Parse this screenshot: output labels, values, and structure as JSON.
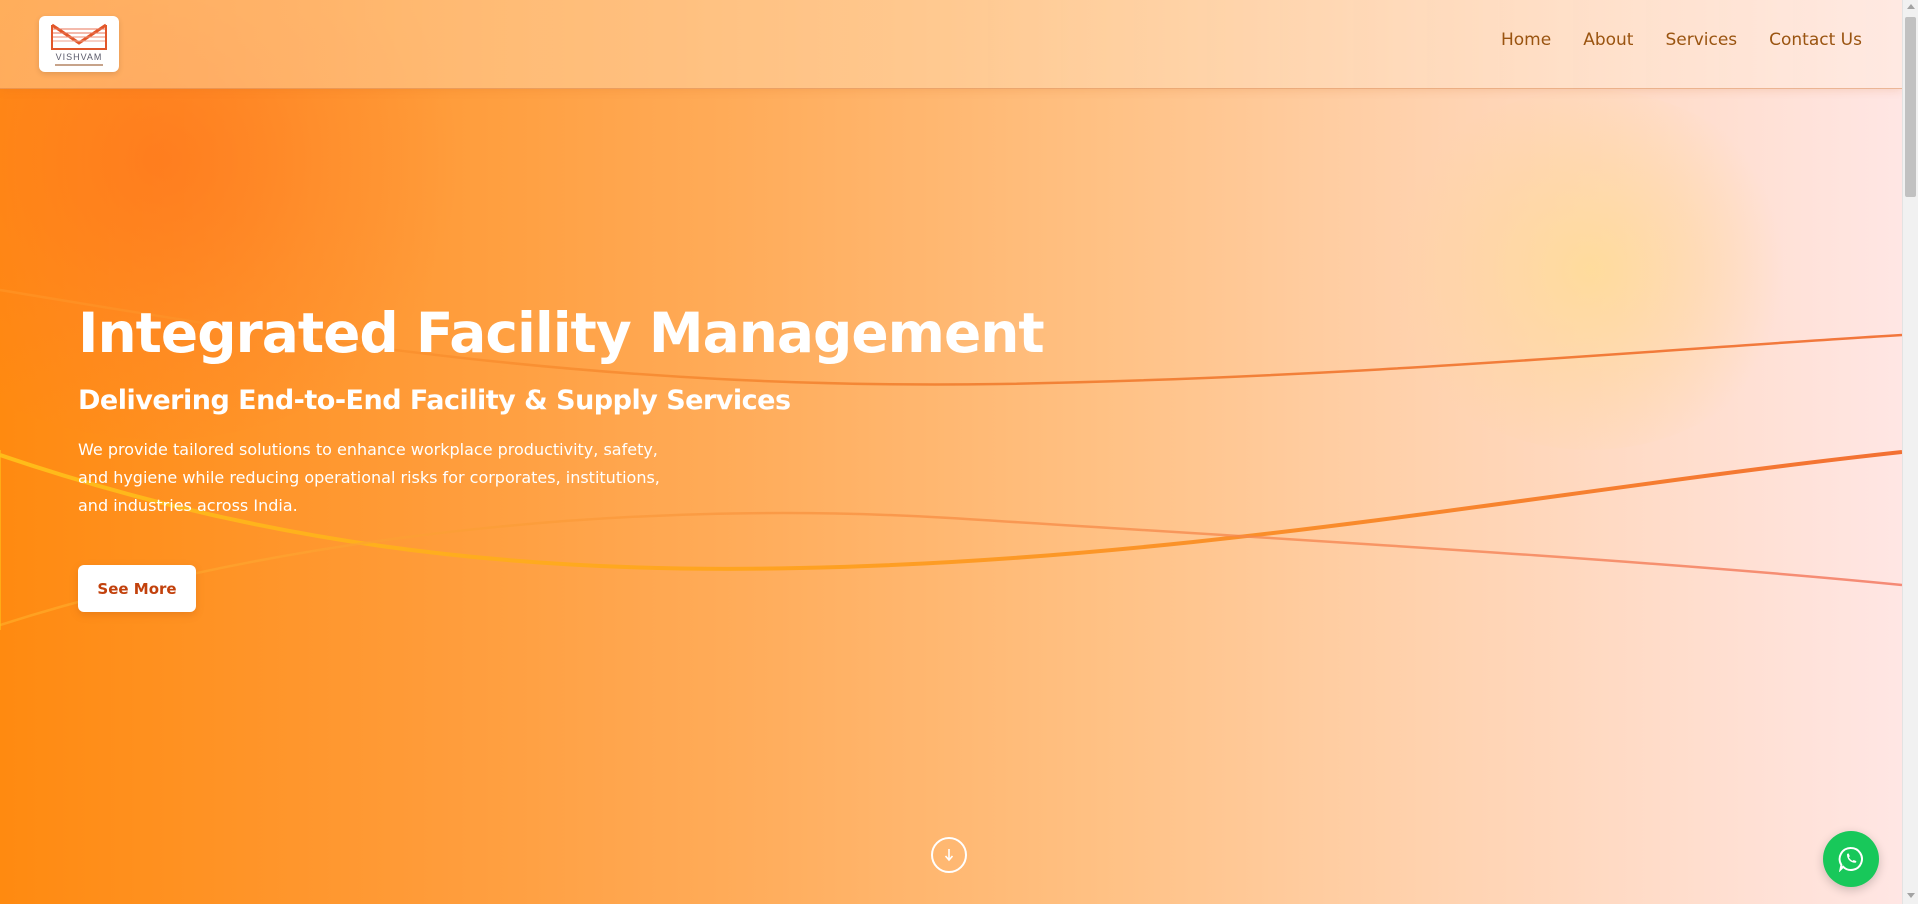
{
  "brand": {
    "name": "VISHVAM",
    "logo_icon": "vishvam-logo-mark"
  },
  "nav": {
    "items": [
      {
        "label": "Home"
      },
      {
        "label": "About"
      },
      {
        "label": "Services"
      },
      {
        "label": "Contact Us"
      }
    ]
  },
  "hero": {
    "title": "Integrated Facility Management",
    "subtitle": "Delivering End-to-End Facility & Supply Services",
    "description": "We provide tailored solutions to enhance workplace productivity, safety, and hygiene while reducing operational risks for corporates, institutions, and industries across India.",
    "cta_label": "See More",
    "scroll_icon": "arrow-down-icon"
  },
  "floating": {
    "whatsapp_icon": "whatsapp-icon"
  },
  "colors": {
    "primary_orange": "#ff8a10",
    "nav_text": "#9a5410",
    "cta_text": "#c2410c",
    "whatsapp_green": "#18c85a"
  }
}
